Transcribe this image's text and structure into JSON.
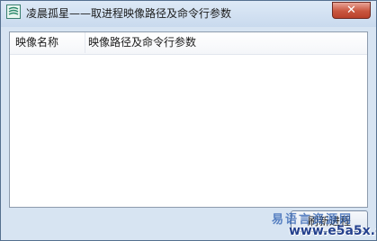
{
  "window": {
    "title": "凌晨孤星——取进程映像路径及命令行参数",
    "close_glyph": "✕"
  },
  "list": {
    "columns": [
      "映像名称",
      "映像路径及命令行参数"
    ],
    "rows": []
  },
  "buttons": {
    "refresh_label": "刷新进程"
  },
  "watermark": {
    "line1": "易语言资源网",
    "line2": "www.e5a5x.com"
  },
  "colors": {
    "titlebar": "#cfdff0",
    "close_button": "#c9563f",
    "window_frame": "#d7e4f2",
    "watermark": "#2d5fb1"
  }
}
